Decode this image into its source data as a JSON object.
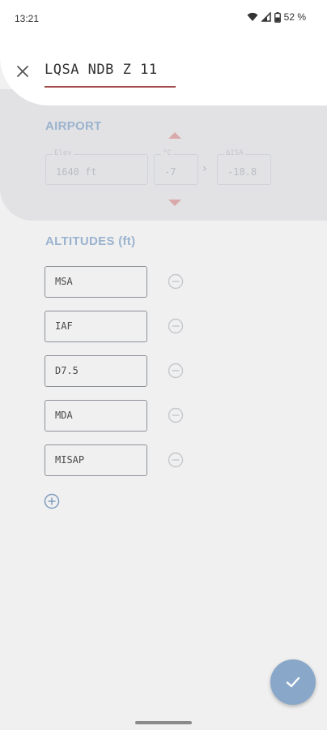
{
  "status_bar": {
    "time": "13:21",
    "battery": "52 %"
  },
  "header": {
    "title": "LQSA NDB Z 11"
  },
  "airport": {
    "section_title": "AIRPORT",
    "elev": {
      "label": "Elev",
      "value": "1640 ft"
    },
    "temp": {
      "label": "°C",
      "value": "-7"
    },
    "disa": {
      "label": "ΔISA",
      "value": "-18.8"
    },
    "arrow_color": "#d9a9ac"
  },
  "altitudes": {
    "section_title": "ALTITUDES (ft)",
    "items": [
      {
        "label": "MSA"
      },
      {
        "label": "IAF"
      },
      {
        "label": "D7.5"
      },
      {
        "label": "MDA"
      },
      {
        "label": "MISAP"
      }
    ]
  },
  "icons": {
    "close": "close-icon",
    "remove": "minus-circle-icon",
    "add": "plus-circle-icon",
    "confirm": "check-icon"
  },
  "colors": {
    "accent": "#89a7c9",
    "section_title": "#9bb3cf",
    "title_underline": "#a24b4b"
  }
}
